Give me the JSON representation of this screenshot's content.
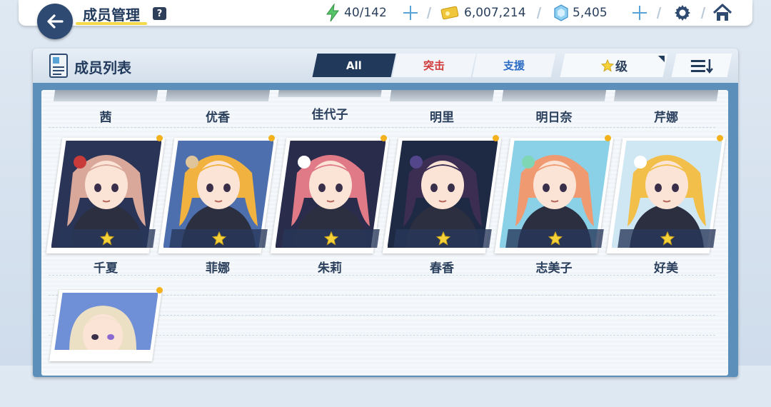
{
  "header": {
    "title": "成员管理",
    "help": "?",
    "ap": "40/142",
    "credits": "6,007,214",
    "gems": "5,405"
  },
  "panel": {
    "title": "成员列表",
    "tabs": [
      {
        "label": "All",
        "active": true
      },
      {
        "label": "突击",
        "active": false
      },
      {
        "label": "支援",
        "active": false
      }
    ],
    "sort_label": "级",
    "colors": {
      "strike": "#d13a3a",
      "support": "#2c6cc4",
      "active_tab": "#213a5c"
    }
  },
  "top_row": [
    "茜",
    "优香",
    "佳代子",
    "明里",
    "明日奈",
    "芹娜"
  ],
  "students": [
    {
      "name": "千夏",
      "stars": 1,
      "hair": "#d9a89a",
      "bg": "#2a3457",
      "accent": "#c93a3a"
    },
    {
      "name": "菲娜",
      "stars": 1,
      "hair": "#f1b23f",
      "bg": "#4d6fae",
      "accent": "#e0c59a"
    },
    {
      "name": "朱莉",
      "stars": 1,
      "hair": "#e07a86",
      "bg": "#2a2c4c",
      "accent": "#ffffff"
    },
    {
      "name": "春香",
      "stars": 1,
      "hair": "#3b2e52",
      "bg": "#1e2a44",
      "accent": "#53468a"
    },
    {
      "name": "志美子",
      "stars": 1,
      "hair": "#f09a72",
      "bg": "#8ad0e6",
      "accent": "#7fd6b5"
    },
    {
      "name": "好美",
      "stars": 1,
      "hair": "#f2c04a",
      "bg": "#cfe6f3",
      "accent": "#ffffff"
    }
  ],
  "bottom_row": [
    {
      "name": "",
      "hair": "#ece0c4",
      "bg": "#6f8fd6"
    }
  ]
}
